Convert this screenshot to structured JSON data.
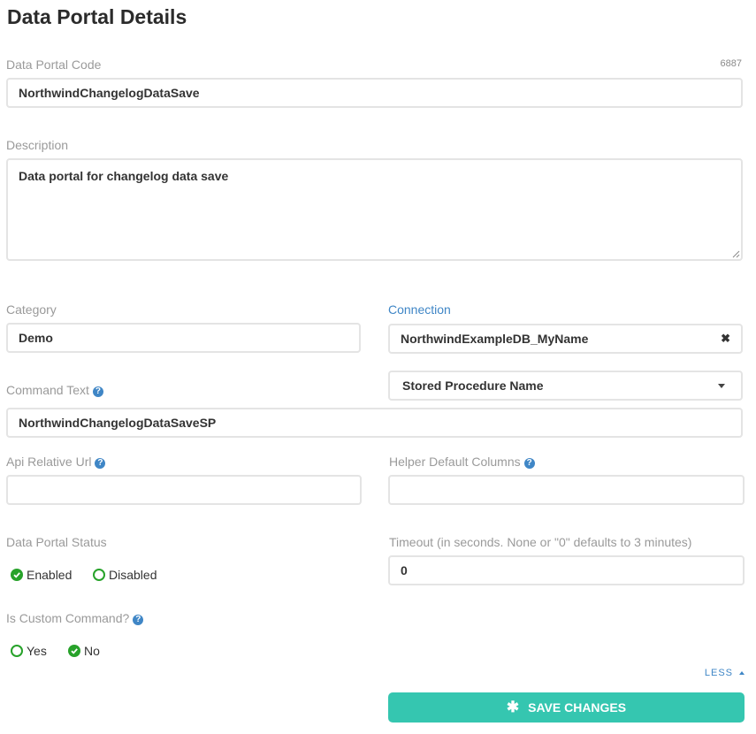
{
  "page": {
    "title": "Data Portal Details"
  },
  "code": {
    "label": "Data Portal Code",
    "id": "6887",
    "value": "NorthwindChangelogDataSave"
  },
  "description": {
    "label": "Description",
    "value": "Data portal for changelog data save"
  },
  "category": {
    "label": "Category",
    "value": "Demo"
  },
  "connection": {
    "label": "Connection",
    "value": "NorthwindExampleDB_MyName",
    "clear": "✖"
  },
  "command": {
    "label": "Command Text",
    "type": "Stored Procedure Name",
    "value": "NorthwindChangelogDataSaveSP"
  },
  "api_url": {
    "label": "Api Relative Url",
    "value": ""
  },
  "helper_columns": {
    "label": "Helper Default Columns",
    "value": ""
  },
  "status": {
    "label": "Data Portal Status",
    "options": [
      "Enabled",
      "Disabled"
    ],
    "selected": "Enabled"
  },
  "timeout": {
    "label": "Timeout (in seconds. None or \"0\" defaults to 3 minutes)",
    "value": "0"
  },
  "custom_command": {
    "label": "Is Custom Command?",
    "options": [
      "Yes",
      "No"
    ],
    "selected": "No"
  },
  "toggle": {
    "label": "LESS"
  },
  "save": {
    "label": "SAVE CHANGES"
  },
  "colors": {
    "accent": "#35c6b0",
    "link": "#3f86c6",
    "radio": "#27a22a"
  },
  "icons": {
    "help": "question-circle-icon",
    "save": "asterisk-icon",
    "clear": "times-icon",
    "dropdown": "caret-down-icon",
    "toggle": "caret-up-icon"
  }
}
